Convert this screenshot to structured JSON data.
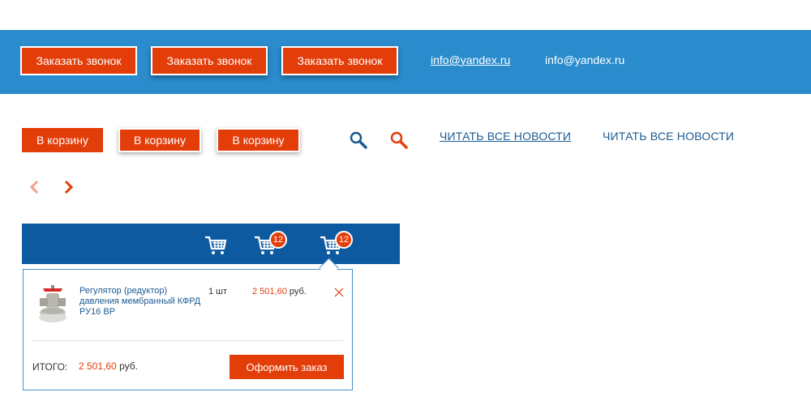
{
  "header": {
    "call_buttons": [
      "Заказать звонок",
      "Заказать звонок",
      "Заказать звонок"
    ],
    "emails": [
      "info@yandex.ru",
      "info@yandex.ru"
    ]
  },
  "actions": {
    "cart_buttons": [
      "В корзину",
      "В корзину",
      "В корзину"
    ],
    "news_links": [
      "ЧИТАТЬ ВСЕ НОВОСТИ",
      "ЧИТАТЬ ВСЕ НОВОСТИ"
    ]
  },
  "cart": {
    "badges": [
      "12",
      "12"
    ],
    "item": {
      "name": "Регулятор (редуктор) давления мембранный КФРД РУ16 ВР",
      "qty": "1 шт",
      "price_value": "2 501,60",
      "price_currency": "руб."
    },
    "total_label": "ИТОГО:",
    "total_value": "2 501,60",
    "total_currency": "руб.",
    "checkout_label": "Оформить заказ"
  },
  "colors": {
    "accent": "#e33d0a",
    "header_blue": "#2a8ccd",
    "cart_bar_blue": "#0d5aa0",
    "link_blue": "#1a5a91"
  }
}
